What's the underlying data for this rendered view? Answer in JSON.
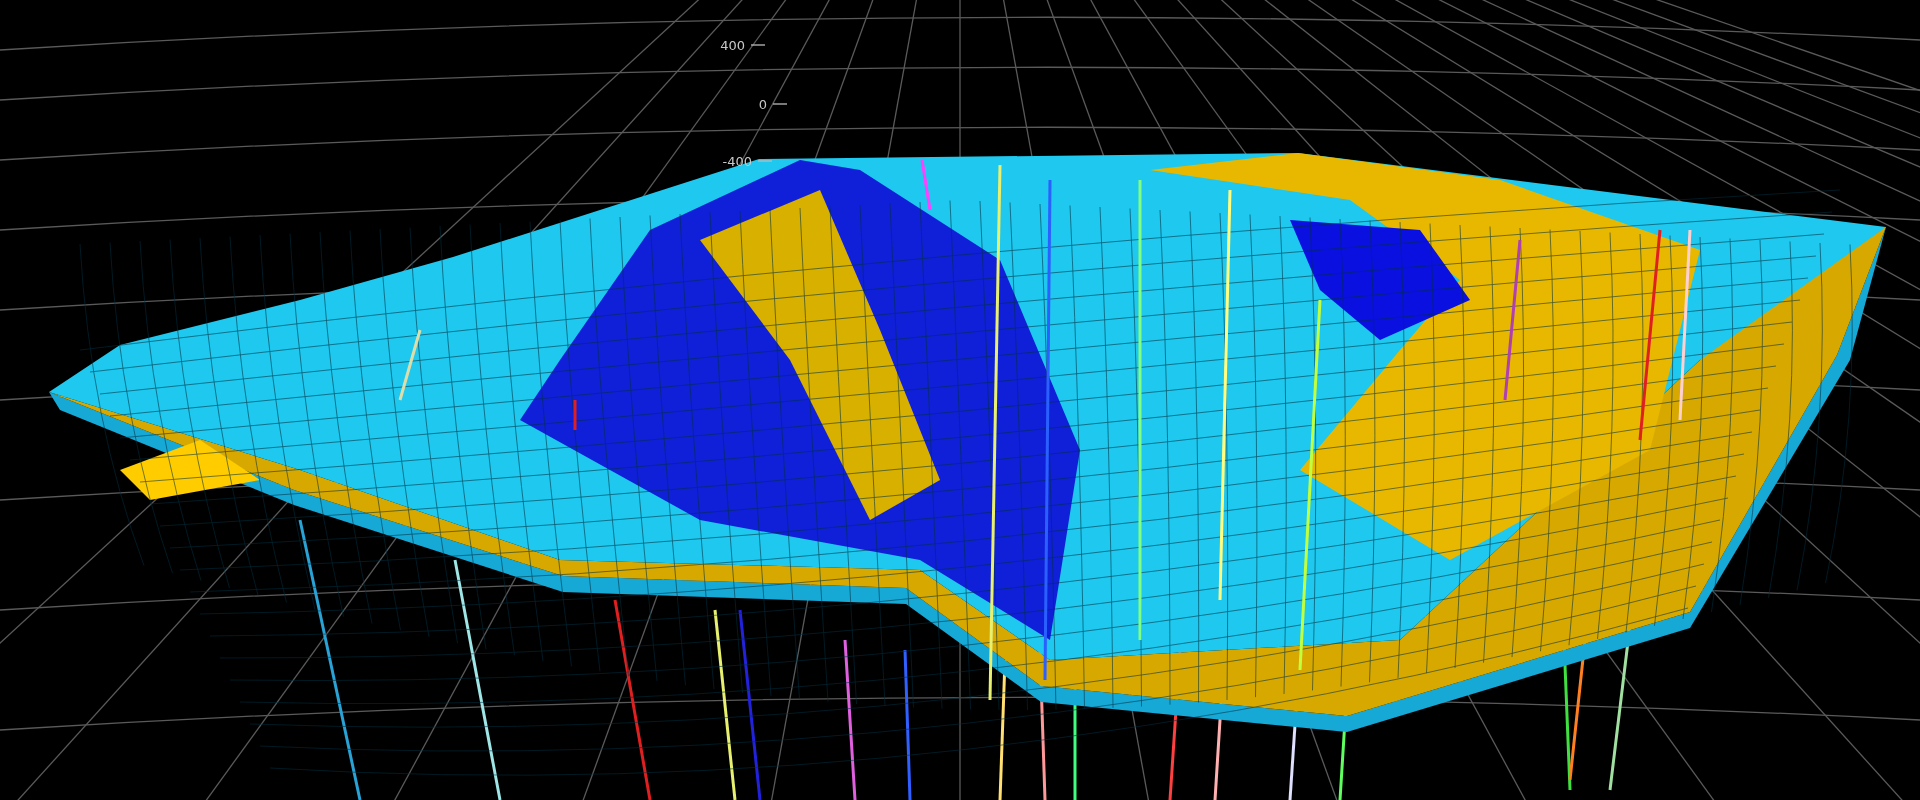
{
  "viewport": {
    "vertical_axis": {
      "ticks": [
        "400",
        "0",
        "-400"
      ]
    }
  }
}
